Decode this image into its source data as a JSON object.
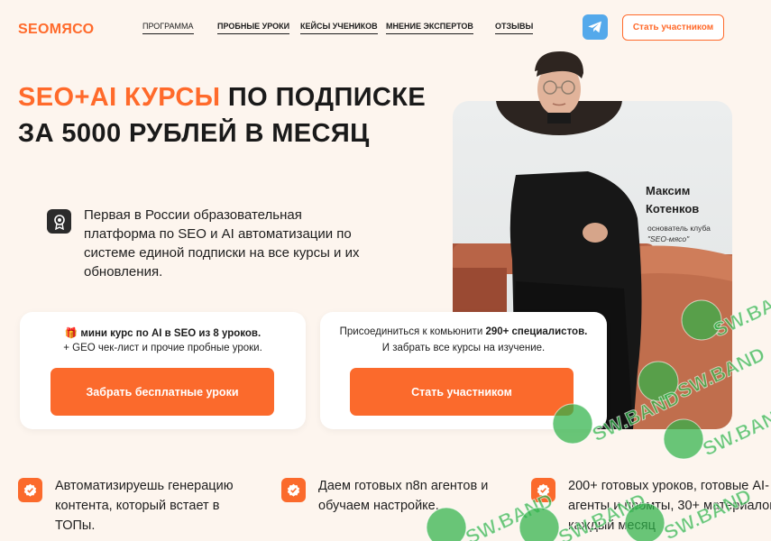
{
  "header": {
    "logo": "SEOМЯСО",
    "nav": [
      "ПРОГРАММА",
      "ПРОБНЫЕ УРОКИ",
      "КЕЙСЫ УЧЕНИКОВ",
      "МНЕНИЕ ЭКСПЕРТОВ",
      "ОТЗЫВЫ"
    ],
    "cta_label": "Стать участником"
  },
  "hero": {
    "headline_accent": "SEO+AI КУРСЫ",
    "headline_rest": " ПО ПОДПИСКЕ",
    "headline_line2": "ЗА 5000 РУБЛЕЙ В МЕСЯЦ",
    "intro": "Первая в России образовательная платформа по SEO и AI автоматизации по системе единой подписки на все курсы и их обновления."
  },
  "person": {
    "first_name": "Максим",
    "last_name": "Котенков",
    "role": "основатель клуба",
    "club": "\"SEO-мясо\""
  },
  "cards": [
    {
      "emoji": "🎁",
      "line1": "мини курс по AI в SEO из 8 уроков.",
      "line2": "+ GEO чек-лист и прочие пробные уроки.",
      "button": "Забрать бесплатные уроки"
    },
    {
      "line1_prefix": "Присоединиться к комьюнити ",
      "line1_bold": "290+ специалистов.",
      "line2": "И забрать все курсы на изучение.",
      "button": "Стать участником"
    }
  ],
  "features": [
    "Автоматизируешь генерацию контента, который встает в ТОПы.",
    "Даем готовых n8n агентов и обучаем настройке.",
    "200+ готовых уроков, готовые AI-агенты и промты, 30+ материалов каждый месяц"
  ],
  "watermark": "SW.BAND",
  "colors": {
    "accent": "#ff6a2b",
    "telegram": "#54a9eb",
    "background": "#fdf5ee",
    "watermark": "#2fb34a"
  }
}
